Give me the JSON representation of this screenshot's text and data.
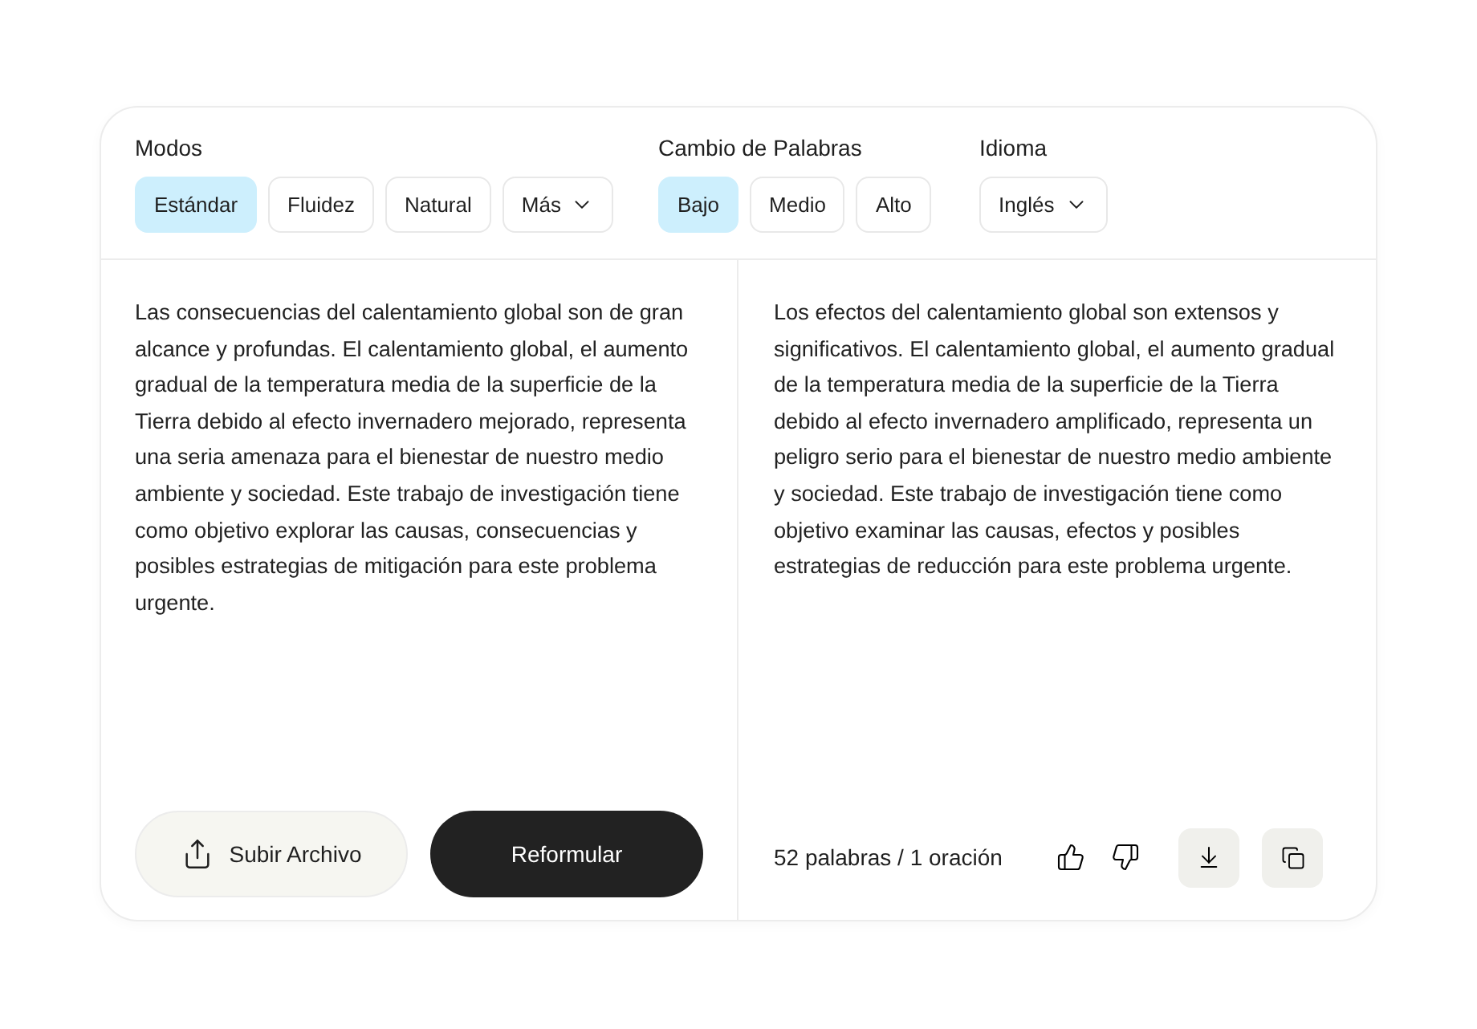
{
  "groups": [
    {
      "label": "Modos",
      "options": [
        {
          "label": "Estándar",
          "selected": true,
          "kind": "chip"
        },
        {
          "label": "Fluidez",
          "selected": false,
          "kind": "chip"
        },
        {
          "label": "Natural",
          "selected": false,
          "kind": "chip"
        },
        {
          "label": "Más",
          "selected": false,
          "kind": "dropdown"
        }
      ]
    },
    {
      "label": "Cambio de Palabras",
      "options": [
        {
          "label": "Bajo",
          "selected": true,
          "kind": "chip"
        },
        {
          "label": "Medio",
          "selected": false,
          "kind": "chip"
        },
        {
          "label": "Alto",
          "selected": false,
          "kind": "chip"
        }
      ]
    },
    {
      "label": "Idioma",
      "options": [
        {
          "label": "Inglés",
          "selected": false,
          "kind": "dropdown"
        }
      ]
    }
  ],
  "input_text": "Las consecuencias del calentamiento global son de gran alcance y profundas. El calentamiento global, el aumento gradual de la temperatura media de la superficie de la Tierra debido al efecto invernadero mejorado, representa una seria amenaza para el bienestar de nuestro medio ambiente y sociedad. Este trabajo de investigación tiene como objetivo explorar las causas, consecuencias y posibles estrategias de mitigación para este problema urgente.",
  "output_text": "Los efectos del calentamiento global son extensos y significativos. El calentamiento global, el aumento gradual de la temperatura media de la superficie de la Tierra debido al efecto invernadero amplificado, representa un peligro serio para el bienestar de nuestro medio ambiente y sociedad. Este trabajo de investigación tiene como objetivo examinar las causas, efectos y posibles estrategias de reducción para este problema urgente.",
  "upload_button": "Subir Archivo",
  "rephrase_button": "Reformular",
  "stats": "52 palabras / 1 oración"
}
